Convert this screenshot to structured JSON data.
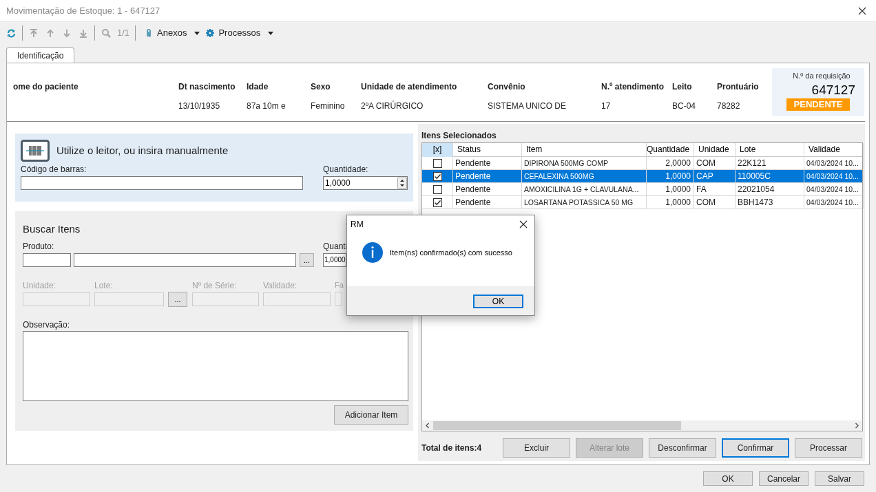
{
  "window": {
    "title": "Movimentação de Estoque: 1 - 647127"
  },
  "toolbar": {
    "buttons": [
      {
        "kind": "refresh",
        "disabled": false
      },
      {
        "kind": "first",
        "disabled": true
      },
      {
        "kind": "previous",
        "disabled": true
      },
      {
        "kind": "next",
        "disabled": true
      },
      {
        "kind": "last",
        "disabled": true
      },
      {
        "kind": "search",
        "disabled": true
      }
    ],
    "page": "1/1",
    "menus": [
      {
        "kind": "attach",
        "label": "Anexos"
      },
      {
        "kind": "gear",
        "label": "Processos"
      }
    ]
  },
  "tabs": [
    {
      "label": "Identificação",
      "selected": true
    }
  ],
  "patient": [
    {
      "label": "ome do paciente"
    },
    {
      "label": "Dt nascimento",
      "value": "13/10/1935"
    },
    {
      "label": "Idade",
      "value": "87a 10m  e"
    },
    {
      "label": "Sexo",
      "value": "Feminino"
    },
    {
      "label": "Unidade de atendimento",
      "value": "2ºA CIRÚRGICO"
    },
    {
      "label": "Convênio",
      "value": "SISTEMA UNICO DE"
    },
    {
      "label": "N.º atendimento",
      "value": "17"
    },
    {
      "label": "Leito",
      "value": "BC-04"
    },
    {
      "label": "Prontuário",
      "value": "78282"
    }
  ],
  "requisition": {
    "label": "N.º da requisição",
    "number": "647127",
    "status": "PENDENTE"
  },
  "barcode": {
    "title": "Utilize o leitor, ou insira manualmente",
    "code_label": "Código de barras:",
    "quantity_label": "Quantidade:",
    "quantity_value": "1,0000"
  },
  "search": {
    "title": "Buscar Itens",
    "product_label": "Produto:",
    "browse_button": "...",
    "quantity_label": "Quanti",
    "quantity_value": "1,0000",
    "fields": [
      {
        "kind": "field",
        "label": "Unidade:",
        "disabled": true
      },
      {
        "kind": "field",
        "label": "Lote:",
        "disabled": true
      },
      {
        "kind": "button",
        "label": "..."
      },
      {
        "kind": "field",
        "label": "Nº de Série:",
        "disabled": true
      },
      {
        "kind": "field",
        "label": "Validade:",
        "disabled": true
      },
      {
        "kind": "field",
        "label": "Fa",
        "disabled": true
      }
    ],
    "observation_label": "Observação:",
    "add_button": "Adicionar Item"
  },
  "items": {
    "title": "Itens Selecionados",
    "columns": [
      "[x]",
      "Status",
      "Item",
      "Quantidade",
      "Unidade",
      "Lote",
      "Validade"
    ],
    "rows": [
      {
        "checked": false,
        "selected": false,
        "status": "Pendente",
        "item": "DIPIRONA 500MG COMP",
        "quantity": "2,0000",
        "unit": "COM",
        "lot": "22K121",
        "validity": "04/03/2024 10..."
      },
      {
        "checked": true,
        "selected": true,
        "status": "Pendente",
        "item": "CEFALEXINA 500MG",
        "quantity": "1,0000",
        "unit": "CAP",
        "lot": "110005C",
        "validity": "04/03/2024 10..."
      },
      {
        "checked": false,
        "selected": false,
        "status": "Pendente",
        "item": "AMOXICILINA 1G + CLAVULANA...",
        "quantity": "1,0000",
        "unit": "FA",
        "lot": "22021054",
        "validity": "04/03/2024 10..."
      },
      {
        "checked": true,
        "selected": false,
        "status": "Pendente",
        "item": "LOSARTANA POTASSICA 50 MG",
        "quantity": "1,0000",
        "unit": "COM",
        "lot": "BBH1473",
        "validity": "04/03/2024 10..."
      }
    ],
    "total": "Total de itens:4",
    "actions": [
      {
        "label": "Excluir",
        "disabled": false,
        "focused": false
      },
      {
        "label": "Alterar lote",
        "disabled": true,
        "focused": false
      },
      {
        "label": "Desconfirmar",
        "disabled": false,
        "focused": false
      },
      {
        "label": "Confirmar",
        "disabled": false,
        "focused": true
      },
      {
        "label": "Processar",
        "disabled": false,
        "focused": false
      }
    ]
  },
  "footer_buttons": [
    "OK",
    "Cancelar",
    "Salvar"
  ],
  "dialog": {
    "title": "RM",
    "message": "Item(ns) confirmado(s) com sucesso",
    "button": "OK"
  }
}
